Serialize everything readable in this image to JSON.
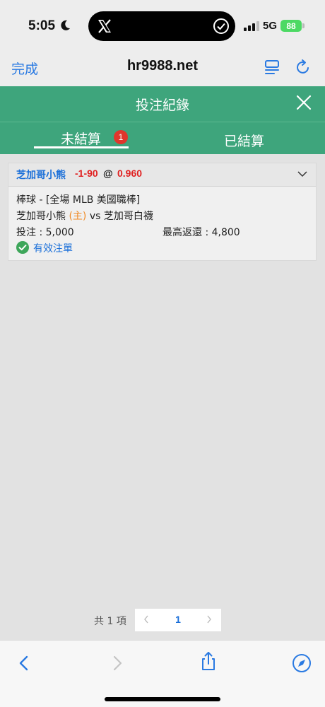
{
  "status_bar": {
    "time": "5:05",
    "network": "5G",
    "battery": "88"
  },
  "browser": {
    "done_label": "完成",
    "url": "hr9988.net"
  },
  "app": {
    "title": "投注紀錄",
    "tabs": [
      {
        "label": "未結算",
        "badge": "1",
        "active": true
      },
      {
        "label": "已結算",
        "active": false
      }
    ]
  },
  "bet": {
    "team_pick": "芝加哥小熊",
    "handicap": "-1-90",
    "at": "@",
    "odds": "0.960",
    "sport_line": "棒球 - [全場 MLB 美國職棒]",
    "home_team": "芝加哥小熊",
    "home_tag": "(主)",
    "vs": "vs",
    "away_team": "芝加哥白襪",
    "stake": "投注 : 5,000",
    "max_payout": "最高返還 : 4,800",
    "status": "有效注單"
  },
  "pagination": {
    "total": "共 1 項",
    "current_page": "1"
  },
  "colors": {
    "header_green": "#3ea57c",
    "link_blue": "#1a6fd9",
    "odds_red": "#e02020",
    "home_orange": "#f08a24",
    "badge_red": "#e0362c",
    "valid_green": "#3ea65a"
  }
}
